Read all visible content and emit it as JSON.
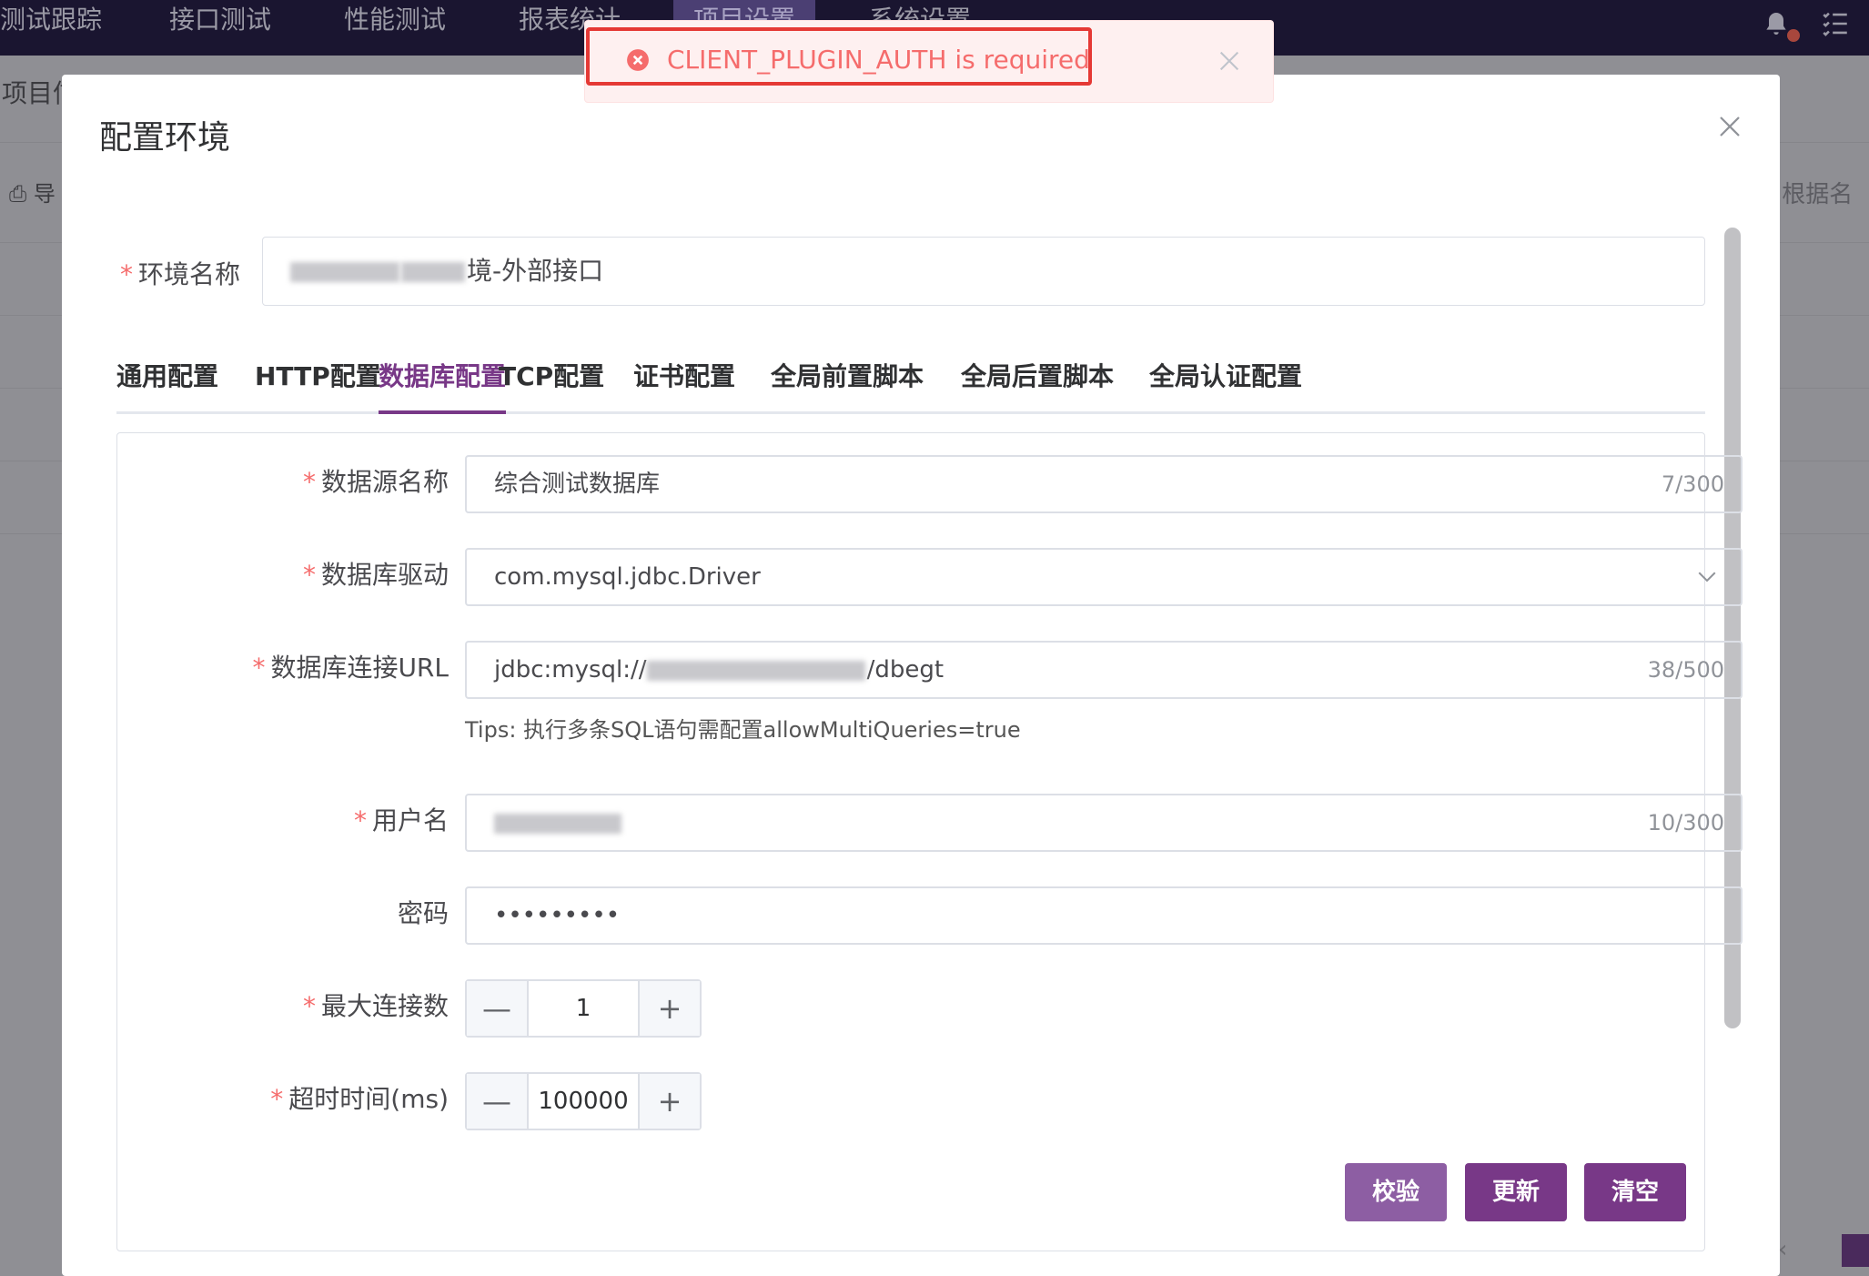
{
  "nav": {
    "items": [
      "测试跟踪",
      "接口测试",
      "性能测试",
      "报表统计",
      "项目设置",
      "系统设置"
    ],
    "active_index": 4
  },
  "background": {
    "title": "项目信",
    "left_item": "导",
    "search_placeholder": "根据名"
  },
  "toast": {
    "message": "CLIENT_PLUGIN_AUTH is required",
    "color": "#f56c6c",
    "highlight_color": "#e53935"
  },
  "dialog": {
    "title": "配置环境",
    "env_name": {
      "label": "环境名称",
      "value_suffix": "境-外部接口"
    },
    "tabs": [
      "通用配置",
      "HTTP配置",
      "数据库配置",
      "TCP配置",
      "证书配置",
      "全局前置脚本",
      "全局后置脚本",
      "全局认证配置"
    ],
    "active_tab": 2,
    "db": {
      "datasource_label": "数据源名称",
      "datasource_value": "综合测试数据库",
      "datasource_count": "7/300",
      "driver_label": "数据库驱动",
      "driver_value": "com.mysql.jdbc.Driver",
      "url_label": "数据库连接URL",
      "url_prefix": "jdbc:mysql://",
      "url_suffix": "/dbegt",
      "url_count": "38/500",
      "tips": "Tips: 执行多条SQL语句需配置allowMultiQueries=true",
      "username_label": "用户名",
      "username_count": "10/300",
      "password_label": "密码",
      "password_value": "•••••••••",
      "max_conn_label": "最大连接数",
      "max_conn_value": "1",
      "timeout_label": "超时时间(ms)",
      "timeout_value": "100000",
      "minus": "—",
      "plus": "+"
    },
    "buttons": {
      "validate": "校验",
      "update": "更新",
      "clear": "清空"
    },
    "required_mark": "*"
  },
  "colors": {
    "accent": "#783887",
    "accent_light": "#8d5ea3",
    "nav_bg": "#1a1530"
  }
}
